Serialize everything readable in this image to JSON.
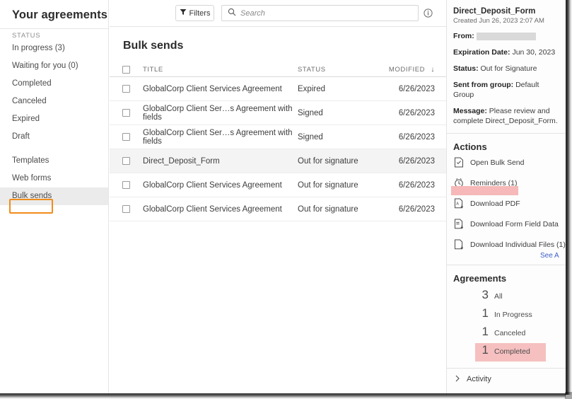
{
  "sidebar": {
    "title": "Your agreements",
    "status_label": "STATUS",
    "items": [
      {
        "label": "In progress (3)",
        "selected": false
      },
      {
        "label": "Waiting for you (0)",
        "selected": false
      },
      {
        "label": "Completed",
        "selected": false
      },
      {
        "label": "Canceled",
        "selected": false
      },
      {
        "label": "Expired",
        "selected": false
      },
      {
        "label": "Draft",
        "selected": false
      }
    ],
    "items2": [
      {
        "label": "Templates",
        "selected": false
      },
      {
        "label": "Web forms",
        "selected": false
      },
      {
        "label": "Bulk sends",
        "selected": true
      }
    ],
    "annotation_color": "#f08c1c"
  },
  "toolbar": {
    "filters_label": "Filters",
    "search_placeholder": "Search",
    "search_value": "",
    "filter_icon": "funnel-icon",
    "search_icon": "search-icon",
    "info_icon": "info-icon"
  },
  "list": {
    "title": "Bulk sends",
    "columns": {
      "title": "TITLE",
      "status": "STATUS",
      "modified": "MODIFIED",
      "sort_arrow": "↓"
    },
    "rows": [
      {
        "title": "GlobalCorp Client Services Agreement",
        "status": "Expired",
        "modified": "6/26/2023",
        "selected": false
      },
      {
        "title": "GlobalCorp Client Ser…s Agreement with fields",
        "status": "Signed",
        "modified": "6/26/2023",
        "selected": false
      },
      {
        "title": "GlobalCorp Client Ser…s Agreement with fields",
        "status": "Signed",
        "modified": "6/26/2023",
        "selected": false
      },
      {
        "title": "Direct_Deposit_Form",
        "status": "Out for signature",
        "modified": "6/26/2023",
        "selected": true
      },
      {
        "title": "GlobalCorp Client Services Agreement",
        "status": "Out for signature",
        "modified": "6/26/2023",
        "selected": false
      },
      {
        "title": "GlobalCorp Client Services Agreement",
        "status": "Out for signature",
        "modified": "6/26/2023",
        "selected": false
      }
    ]
  },
  "detail": {
    "doc_name": "Direct_Deposit_Form",
    "created": "Created Jun 26, 2023 2:07 AM",
    "from_label": "From:",
    "from_value": "",
    "expiration_label": "Expiration Date:",
    "expiration_value": "Jun 30, 2023",
    "status_label": "Status:",
    "status_value": "Out for Signature",
    "group_label": "Sent from group:",
    "group_value": "Default Group",
    "message_label": "Message:",
    "message_value": "Please review and complete Direct_Deposit_Form."
  },
  "actions": {
    "heading": "Actions",
    "items": [
      {
        "label": "Open Bulk Send",
        "icon": "document-check-icon"
      },
      {
        "label": "Reminders (1)",
        "icon": "clock-icon"
      },
      {
        "label": "Download PDF",
        "icon": "pdf-download-icon"
      },
      {
        "label": "Download Form Field Data",
        "icon": "form-download-icon"
      },
      {
        "label": "Download Individual Files (1)",
        "icon": "file-download-icon"
      }
    ],
    "see_all": "See A",
    "highlight_color": "#f6b8b8"
  },
  "agreements": {
    "heading": "Agreements",
    "rows": [
      {
        "count": "3",
        "label": "All",
        "highlighted": false
      },
      {
        "count": "1",
        "label": "In Progress",
        "highlighted": false
      },
      {
        "count": "1",
        "label": "Canceled",
        "highlighted": false
      },
      {
        "count": "1",
        "label": "Completed",
        "highlighted": true
      }
    ],
    "highlight_color": "#f6c0c0"
  },
  "activity": {
    "label": "Activity",
    "chevron_icon": "chevron-right-icon"
  }
}
